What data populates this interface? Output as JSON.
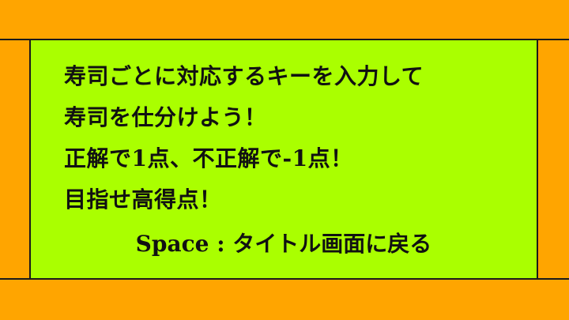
{
  "colors": {
    "background": "#FFA500",
    "panel": "#AAFF00",
    "border": "#1a1a1a",
    "text": "#111111"
  },
  "instructions": {
    "lines": [
      "寿司ごとに対応するキーを入力して",
      "寿司を仕分けよう！",
      "正解で1点、不正解で-1点！",
      "目指せ高得点！"
    ]
  },
  "hint": {
    "text": "Space : タイトル画面に戻る"
  }
}
